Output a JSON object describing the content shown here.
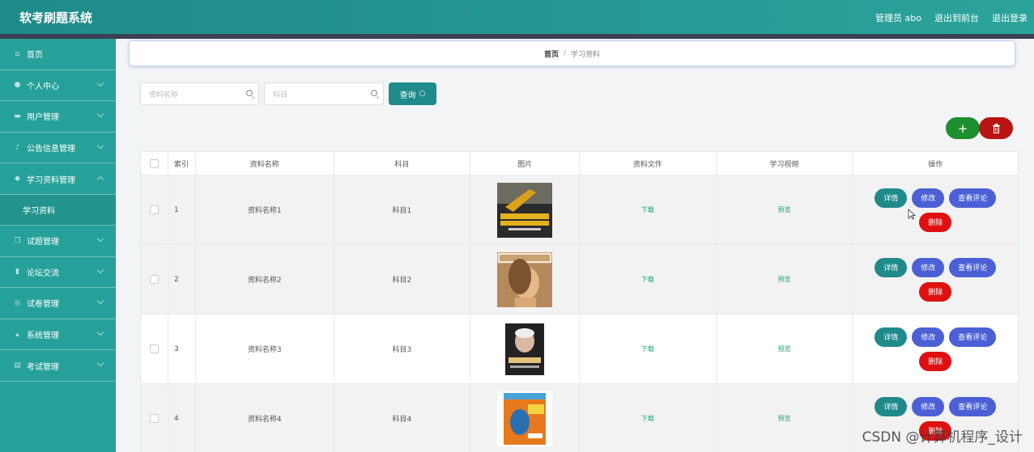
{
  "header": {
    "title": "软考刷题系统",
    "admin_label": "管理员 abo",
    "frontend_link": "退出到前台",
    "logout_link": "退出登录"
  },
  "sidebar": {
    "items": [
      {
        "label": "首页",
        "icon": "home-icon"
      },
      {
        "label": "个人中心",
        "icon": "user-icon"
      },
      {
        "label": "用户管理",
        "icon": "users-icon"
      },
      {
        "label": "公告信息管理",
        "icon": "mic-icon"
      },
      {
        "label": "学习资料管理",
        "icon": "book-icon"
      },
      {
        "label": "学习资料",
        "icon": ""
      },
      {
        "label": "试题管理",
        "icon": "copy-icon"
      },
      {
        "label": "论坛交流",
        "icon": "chart-icon"
      },
      {
        "label": "试卷管理",
        "icon": "paper-icon"
      },
      {
        "label": "系统管理",
        "icon": "settings-icon"
      },
      {
        "label": "考试管理",
        "icon": "exam-icon"
      }
    ]
  },
  "breadcrumb": {
    "home": "首页",
    "separator": "/",
    "current": "学习资料"
  },
  "search": {
    "name_placeholder": "资料名称",
    "subject_placeholder": "科目",
    "query_label": "查询"
  },
  "toolbar": {
    "add_label": "+",
    "delete_icon": "trash-icon"
  },
  "table": {
    "columns": [
      "索引",
      "资料名称",
      "科目",
      "图片",
      "资料文件",
      "学习视频",
      "操作"
    ],
    "rows": [
      {
        "index": "1",
        "name": "资料名称1",
        "subject": "科目1",
        "file": "下载",
        "video": "预览"
      },
      {
        "index": "2",
        "name": "资料名称2",
        "subject": "科目2",
        "file": "下载",
        "video": "预览"
      },
      {
        "index": "3",
        "name": "资料名称3",
        "subject": "科目3",
        "file": "下载",
        "video": "预览"
      },
      {
        "index": "4",
        "name": "资料名称4",
        "subject": "科目4",
        "file": "下载",
        "video": "预览"
      }
    ],
    "actions": {
      "detail": "详情",
      "edit": "修改",
      "comments": "查看评论",
      "delete": "删除"
    }
  },
  "watermark": "CSDN @计算机程序_设计",
  "colors": {
    "primary": "#26a19a",
    "header": "#1f8a8a",
    "edit": "#4c60d6",
    "danger": "#e01010",
    "add": "#1e8f2e",
    "link": "#19a574"
  }
}
